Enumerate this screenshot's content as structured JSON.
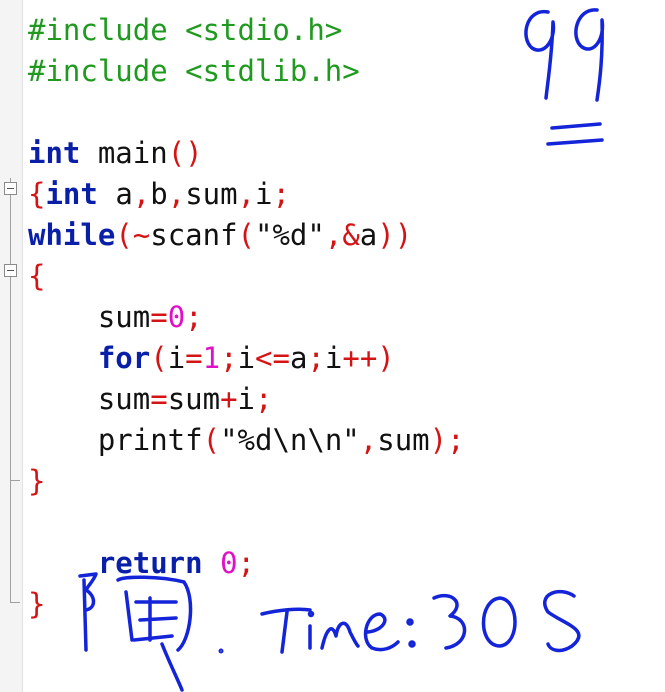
{
  "editor": {
    "lines": [
      {
        "tokens": [
          {
            "t": "#include <stdio.h>",
            "c": "pp"
          }
        ]
      },
      {
        "tokens": [
          {
            "t": "#include <stdlib.h>",
            "c": "pp"
          }
        ]
      },
      {
        "tokens": []
      },
      {
        "tokens": [
          {
            "t": "int",
            "c": "kw"
          },
          {
            "t": " main",
            "c": "id"
          },
          {
            "t": "()",
            "c": "op"
          }
        ]
      },
      {
        "tokens": [
          {
            "t": "{",
            "c": "op"
          },
          {
            "t": "int",
            "c": "kw"
          },
          {
            "t": " a",
            "c": "id"
          },
          {
            "t": ",",
            "c": "op"
          },
          {
            "t": "b",
            "c": "id"
          },
          {
            "t": ",",
            "c": "op"
          },
          {
            "t": "sum",
            "c": "id"
          },
          {
            "t": ",",
            "c": "op"
          },
          {
            "t": "i",
            "c": "id"
          },
          {
            "t": ";",
            "c": "op"
          }
        ]
      },
      {
        "tokens": [
          {
            "t": "while",
            "c": "kw"
          },
          {
            "t": "(~",
            "c": "op"
          },
          {
            "t": "scanf",
            "c": "id"
          },
          {
            "t": "(",
            "c": "op"
          },
          {
            "t": "\"%d\"",
            "c": "str"
          },
          {
            "t": ",&",
            "c": "op"
          },
          {
            "t": "a",
            "c": "id"
          },
          {
            "t": "))",
            "c": "op"
          }
        ]
      },
      {
        "tokens": [
          {
            "t": "{",
            "c": "op"
          }
        ]
      },
      {
        "tokens": [
          {
            "t": "    sum",
            "c": "id"
          },
          {
            "t": "=",
            "c": "op"
          },
          {
            "t": "0",
            "c": "num"
          },
          {
            "t": ";",
            "c": "op"
          }
        ]
      },
      {
        "tokens": [
          {
            "t": "    for",
            "c": "kw"
          },
          {
            "t": "(",
            "c": "op"
          },
          {
            "t": "i",
            "c": "id"
          },
          {
            "t": "=",
            "c": "op"
          },
          {
            "t": "1",
            "c": "num"
          },
          {
            "t": ";",
            "c": "op"
          },
          {
            "t": "i",
            "c": "id"
          },
          {
            "t": "<=",
            "c": "op"
          },
          {
            "t": "a",
            "c": "id"
          },
          {
            "t": ";",
            "c": "op"
          },
          {
            "t": "i",
            "c": "id"
          },
          {
            "t": "++)",
            "c": "op"
          }
        ]
      },
      {
        "tokens": [
          {
            "t": "    sum",
            "c": "id"
          },
          {
            "t": "=",
            "c": "op"
          },
          {
            "t": "sum",
            "c": "id"
          },
          {
            "t": "+",
            "c": "op"
          },
          {
            "t": "i",
            "c": "id"
          },
          {
            "t": ";",
            "c": "op"
          }
        ]
      },
      {
        "tokens": [
          {
            "t": "    printf",
            "c": "id"
          },
          {
            "t": "(",
            "c": "op"
          },
          {
            "t": "\"%d\\n\\n\"",
            "c": "str"
          },
          {
            "t": ",",
            "c": "op"
          },
          {
            "t": "sum",
            "c": "id"
          },
          {
            "t": ");",
            "c": "op"
          }
        ]
      },
      {
        "tokens": [
          {
            "t": "}",
            "c": "op"
          }
        ]
      },
      {
        "tokens": []
      },
      {
        "tokens": [
          {
            "t": "    return",
            "c": "kw"
          },
          {
            "t": " 0",
            "c": "num"
          },
          {
            "t": ";",
            "c": "op"
          }
        ]
      },
      {
        "tokens": [
          {
            "t": "}",
            "c": "op"
          }
        ]
      }
    ]
  },
  "handwriting": {
    "problem_number": "99",
    "note": "阿 Time:30S",
    "ink_color": "#1424d8"
  }
}
